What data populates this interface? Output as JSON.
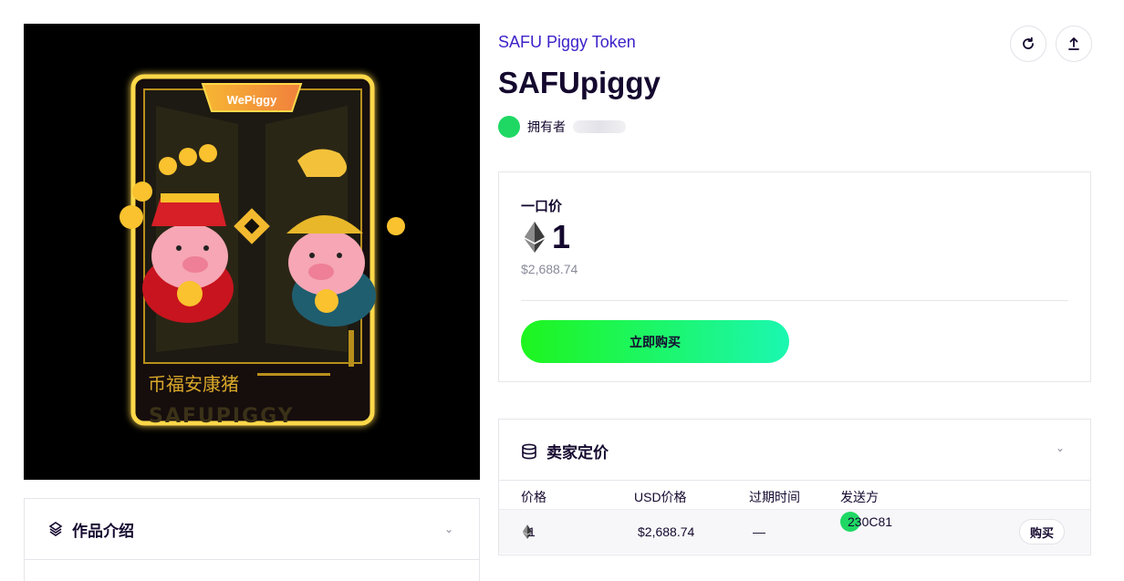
{
  "artwork": {
    "badge_text": "WePiggy",
    "caption_cn": "币福安康猪",
    "caption_en": "SAFUPIGGY"
  },
  "collection_name": "SAFU Piggy Token",
  "nft_title": "SAFUpiggy",
  "owner": {
    "label": "拥有者"
  },
  "actions": {
    "refresh_icon": "refresh-icon",
    "share_icon": "upload-icon"
  },
  "sale": {
    "label": "一口价",
    "price_eth": "1",
    "price_usd": "$2,688.74",
    "buy_label": "立即购买"
  },
  "description": {
    "title": "作品介绍"
  },
  "listings": {
    "title": "卖家定价",
    "columns": [
      "价格",
      "USD价格",
      "过期时间",
      "发送方"
    ],
    "rows": [
      {
        "price": "1",
        "usd": "$2,688.74",
        "expiry": "—",
        "from": "230C81",
        "buy_label": "购买"
      }
    ]
  },
  "colors": {
    "accent_green": "#1ef51e",
    "accent_teal": "#1bf7b1",
    "link": "#3d22c9",
    "text": "#14082e"
  }
}
